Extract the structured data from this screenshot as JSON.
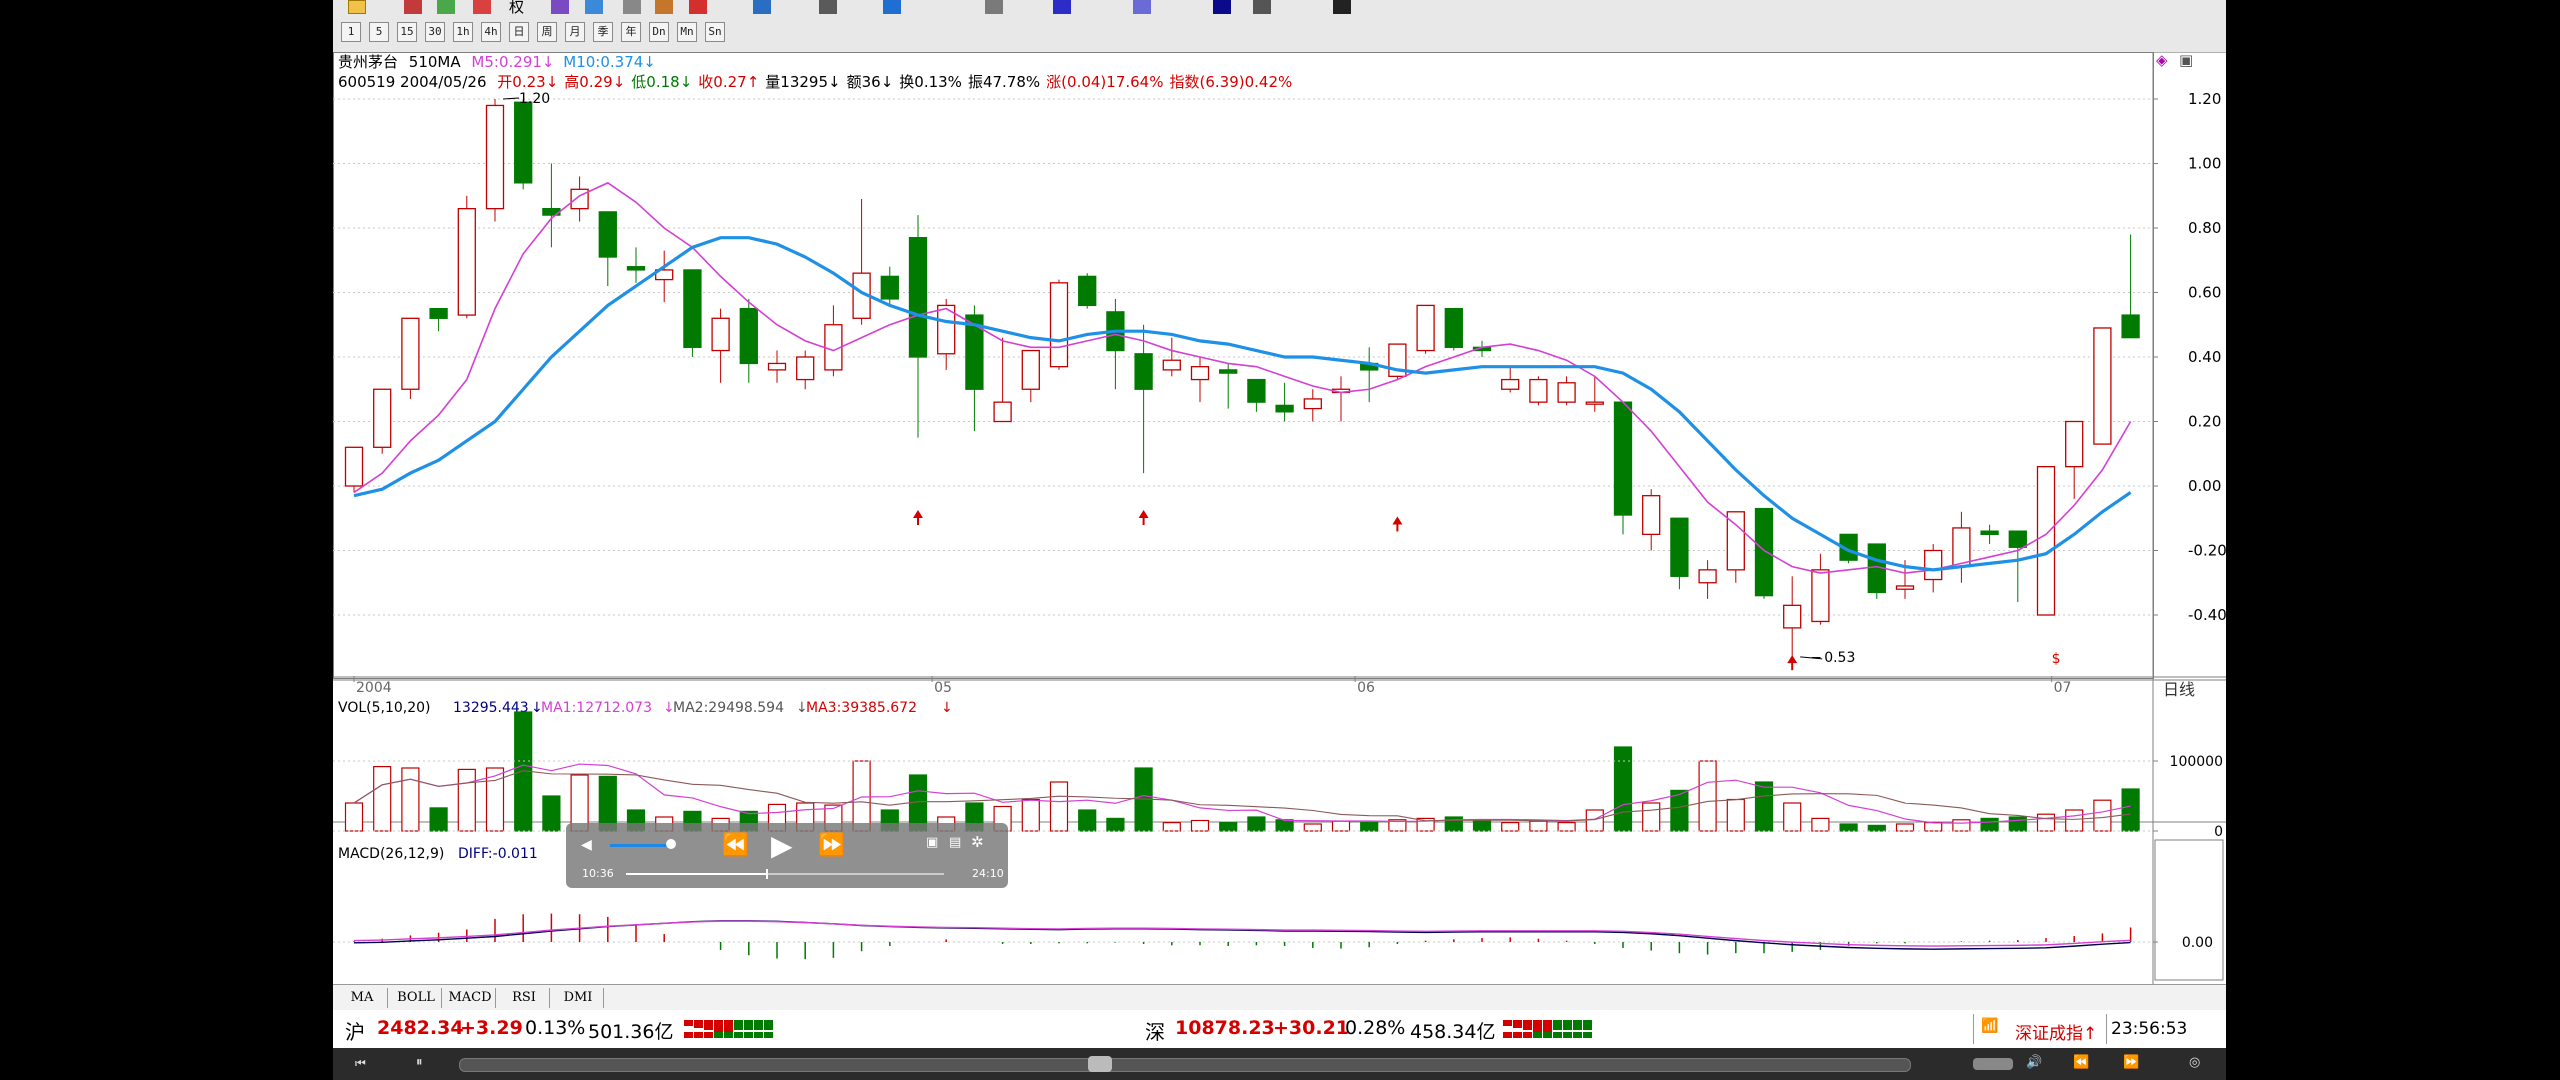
{
  "toolbar": {
    "row1_icons": [
      "arrow-icon",
      "image-icon",
      "globe-icon",
      "flag-icon",
      "text-icon",
      "target-icon",
      "window-icon",
      "palette-icon",
      "save-icon"
    ],
    "row1_label": "权",
    "row2_buttons": [
      "1",
      "5",
      "15",
      "30",
      "1h",
      "4h",
      "日",
      "周",
      "月",
      "季",
      "年",
      "Dn",
      "Mn",
      "Sn"
    ]
  },
  "chart": {
    "stock_name": "贵州茅台",
    "indicator": "510MA",
    "ma5_label": "M5:0.291",
    "ma5_arrow": "↓",
    "ma10_label": "M10:0.374",
    "ma10_arrow": "↓",
    "code_date": "600519 2004/05/26",
    "info": [
      {
        "label": "开",
        "value": "0.23",
        "arrow": "↓",
        "color": "#d40000"
      },
      {
        "label": "高",
        "value": "0.29",
        "arrow": "↓",
        "color": "#d40000"
      },
      {
        "label": "低",
        "value": "0.18",
        "arrow": "↓",
        "color": "#007a00"
      },
      {
        "label": "收",
        "value": "0.27",
        "arrow": "↑",
        "color": "#d40000"
      },
      {
        "label": "量",
        "value": "13295",
        "arrow": "↓",
        "color": "#000"
      },
      {
        "label": "额",
        "value": "36",
        "arrow": "↓",
        "color": "#000"
      },
      {
        "label": "换",
        "value": "0.13%",
        "arrow": "",
        "color": "#000"
      },
      {
        "label": "振",
        "value": "47.78%",
        "arrow": "",
        "color": "#000"
      },
      {
        "label": "涨",
        "value": "(0.04)17.64%",
        "arrow": "",
        "color": "#d40000"
      },
      {
        "label": "指数",
        "value": "(6.39)0.42%",
        "arrow": "",
        "color": "#d40000"
      }
    ],
    "y_ticks": [
      "1.20",
      "1.00",
      "0.80",
      "0.60",
      "0.40",
      "0.20",
      "0.00",
      "-0.20",
      "-0.40"
    ],
    "x_labels": [
      {
        "text": "2004"
      },
      {
        "text": "05"
      },
      {
        "text": "06"
      },
      {
        "text": "07"
      }
    ],
    "period_label": "日线",
    "max_annotation": "1.20",
    "min_annotation": "0.53",
    "vol_header": {
      "name": "VOL(5,10,20)",
      "value": "13295.443",
      "arrow": "↓",
      "ma1": "MA1:12712.073",
      "ma1_arrow": "↓",
      "ma2": "MA2:29498.594",
      "ma2_arrow": "↓",
      "ma3": "MA3:39385.672",
      "ma3_arrow": "↓"
    },
    "vol_ticks": [
      "100000",
      "0"
    ],
    "macd_header": {
      "name": "MACD(26,12,9)",
      "diff": "DIFF:-0.011"
    },
    "macd_tick": "0.00"
  },
  "chart_data": {
    "type": "candlestick",
    "series_ma5_color": "#d43fd4",
    "series_ma10_color": "#1e90e6",
    "up_color": "#c00000",
    "down_color": "#007a00",
    "candles": [
      [
        0.0,
        0.12,
        -0.02,
        0.12
      ],
      [
        0.12,
        0.3,
        0.1,
        0.3
      ],
      [
        0.3,
        0.52,
        0.27,
        0.52
      ],
      [
        0.55,
        0.55,
        0.48,
        0.52
      ],
      [
        0.53,
        0.9,
        0.52,
        0.86
      ],
      [
        0.86,
        1.2,
        0.82,
        1.18
      ],
      [
        1.19,
        1.2,
        0.92,
        0.94
      ],
      [
        0.86,
        1.0,
        0.74,
        0.84
      ],
      [
        0.86,
        0.96,
        0.82,
        0.92
      ],
      [
        0.85,
        0.85,
        0.62,
        0.71
      ],
      [
        0.68,
        0.74,
        0.63,
        0.67
      ],
      [
        0.64,
        0.73,
        0.57,
        0.67
      ],
      [
        0.67,
        0.67,
        0.4,
        0.43
      ],
      [
        0.42,
        0.55,
        0.32,
        0.52
      ],
      [
        0.55,
        0.58,
        0.32,
        0.38
      ],
      [
        0.36,
        0.42,
        0.32,
        0.38
      ],
      [
        0.33,
        0.42,
        0.3,
        0.4
      ],
      [
        0.36,
        0.56,
        0.34,
        0.5
      ],
      [
        0.52,
        0.89,
        0.5,
        0.66
      ],
      [
        0.65,
        0.68,
        0.56,
        0.58
      ],
      [
        0.77,
        0.84,
        0.15,
        0.4
      ],
      [
        0.41,
        0.58,
        0.36,
        0.56
      ],
      [
        0.53,
        0.56,
        0.17,
        0.3
      ],
      [
        0.2,
        0.46,
        0.2,
        0.26
      ],
      [
        0.3,
        0.42,
        0.26,
        0.42
      ],
      [
        0.37,
        0.64,
        0.36,
        0.63
      ],
      [
        0.65,
        0.66,
        0.55,
        0.56
      ],
      [
        0.54,
        0.58,
        0.3,
        0.42
      ],
      [
        0.41,
        0.5,
        0.04,
        0.3
      ],
      [
        0.36,
        0.46,
        0.34,
        0.39
      ],
      [
        0.33,
        0.4,
        0.26,
        0.37
      ],
      [
        0.36,
        0.38,
        0.24,
        0.35
      ],
      [
        0.33,
        0.33,
        0.23,
        0.26
      ],
      [
        0.25,
        0.32,
        0.2,
        0.23
      ],
      [
        0.24,
        0.3,
        0.2,
        0.27
      ],
      [
        0.29,
        0.34,
        0.2,
        0.3
      ],
      [
        0.38,
        0.43,
        0.26,
        0.36
      ],
      [
        0.34,
        0.44,
        0.33,
        0.44
      ],
      [
        0.42,
        0.56,
        0.41,
        0.56
      ],
      [
        0.55,
        0.55,
        0.42,
        0.43
      ],
      [
        0.43,
        0.45,
        0.4,
        0.42
      ],
      [
        0.3,
        0.37,
        0.29,
        0.33
      ],
      [
        0.26,
        0.34,
        0.25,
        0.33
      ],
      [
        0.26,
        0.34,
        0.25,
        0.32
      ],
      [
        0.26,
        0.34,
        0.23,
        0.26
      ],
      [
        0.26,
        0.26,
        -0.15,
        -0.09
      ],
      [
        -0.15,
        -0.01,
        -0.2,
        -0.03
      ],
      [
        -0.1,
        -0.1,
        -0.32,
        -0.28
      ],
      [
        -0.3,
        -0.23,
        -0.35,
        -0.26
      ],
      [
        -0.26,
        -0.08,
        -0.3,
        -0.08
      ],
      [
        -0.07,
        -0.07,
        -0.35,
        -0.34
      ],
      [
        -0.44,
        -0.28,
        -0.53,
        -0.37
      ],
      [
        -0.42,
        -0.21,
        -0.43,
        -0.26
      ],
      [
        -0.15,
        -0.15,
        -0.24,
        -0.23
      ],
      [
        -0.18,
        -0.18,
        -0.35,
        -0.33
      ],
      [
        -0.32,
        -0.23,
        -0.35,
        -0.31
      ],
      [
        -0.29,
        -0.18,
        -0.33,
        -0.2
      ],
      [
        -0.25,
        -0.08,
        -0.3,
        -0.13
      ],
      [
        -0.14,
        -0.12,
        -0.18,
        -0.15
      ],
      [
        -0.14,
        -0.14,
        -0.36,
        -0.19
      ],
      [
        -0.4,
        0.06,
        -0.4,
        0.06
      ],
      [
        0.06,
        0.2,
        -0.04,
        0.2
      ],
      [
        0.13,
        0.49,
        0.13,
        0.49
      ],
      [
        0.53,
        0.78,
        0.46,
        0.46
      ]
    ],
    "ma5": [
      -0.02,
      0.04,
      0.14,
      0.22,
      0.33,
      0.55,
      0.72,
      0.83,
      0.9,
      0.94,
      0.88,
      0.8,
      0.74,
      0.65,
      0.57,
      0.5,
      0.45,
      0.42,
      0.46,
      0.5,
      0.53,
      0.55,
      0.5,
      0.45,
      0.43,
      0.43,
      0.45,
      0.47,
      0.45,
      0.42,
      0.4,
      0.38,
      0.37,
      0.34,
      0.31,
      0.29,
      0.3,
      0.33,
      0.37,
      0.4,
      0.43,
      0.44,
      0.42,
      0.39,
      0.34,
      0.26,
      0.17,
      0.06,
      -0.05,
      -0.12,
      -0.2,
      -0.25,
      -0.27,
      -0.26,
      -0.25,
      -0.27,
      -0.26,
      -0.24,
      -0.22,
      -0.2,
      -0.15,
      -0.06,
      0.05,
      0.2
    ],
    "ma10": [
      -0.03,
      -0.01,
      0.04,
      0.08,
      0.14,
      0.2,
      0.3,
      0.4,
      0.48,
      0.56,
      0.62,
      0.68,
      0.74,
      0.77,
      0.77,
      0.75,
      0.71,
      0.66,
      0.6,
      0.56,
      0.53,
      0.51,
      0.5,
      0.48,
      0.46,
      0.45,
      0.47,
      0.48,
      0.48,
      0.47,
      0.45,
      0.44,
      0.42,
      0.4,
      0.4,
      0.39,
      0.38,
      0.36,
      0.35,
      0.36,
      0.37,
      0.37,
      0.37,
      0.37,
      0.37,
      0.35,
      0.3,
      0.23,
      0.14,
      0.05,
      -0.03,
      -0.1,
      -0.15,
      -0.2,
      -0.23,
      -0.25,
      -0.26,
      -0.25,
      -0.24,
      -0.23,
      -0.21,
      -0.15,
      -0.08,
      -0.02
    ],
    "volume": [
      40000,
      92000,
      90000,
      33000,
      88000,
      90000,
      170000,
      50000,
      80000,
      78000,
      30000,
      20000,
      28000,
      18000,
      28000,
      38000,
      40000,
      37000,
      100000,
      30000,
      80000,
      20000,
      40000,
      35000,
      45000,
      70000,
      30000,
      18000,
      90000,
      12000,
      15000,
      12000,
      20000,
      16000,
      10000,
      14000,
      12000,
      16000,
      18000,
      20000,
      16000,
      12000,
      14000,
      12000,
      30000,
      120000,
      40000,
      58000,
      100000,
      45000,
      70000,
      40000,
      18000,
      10000,
      8000,
      10000,
      12000,
      16000,
      18000,
      20000,
      24000,
      30000,
      44000,
      60000
    ],
    "ylim": [
      -0.53,
      1.2
    ]
  },
  "video_overlay": {
    "time_current": "10:36",
    "time_total": "24:10",
    "volume_pct": 0.8,
    "progress_pct": 0.44
  },
  "tabs": [
    "MA",
    "BOLL",
    "MACD",
    "RSI",
    "DMI"
  ],
  "status": {
    "sh_label": "沪",
    "sh_index": "2482.34",
    "sh_change": "+3.29",
    "sh_pct": "0.13%",
    "sh_amount": "501.36亿",
    "sz_label": "深",
    "sz_index": "10878.23",
    "sz_change": "+30.21",
    "sz_pct": "0.28%",
    "sz_amount": "458.34亿",
    "ticker": "深证成指↑",
    "clock": "23:56:53"
  }
}
